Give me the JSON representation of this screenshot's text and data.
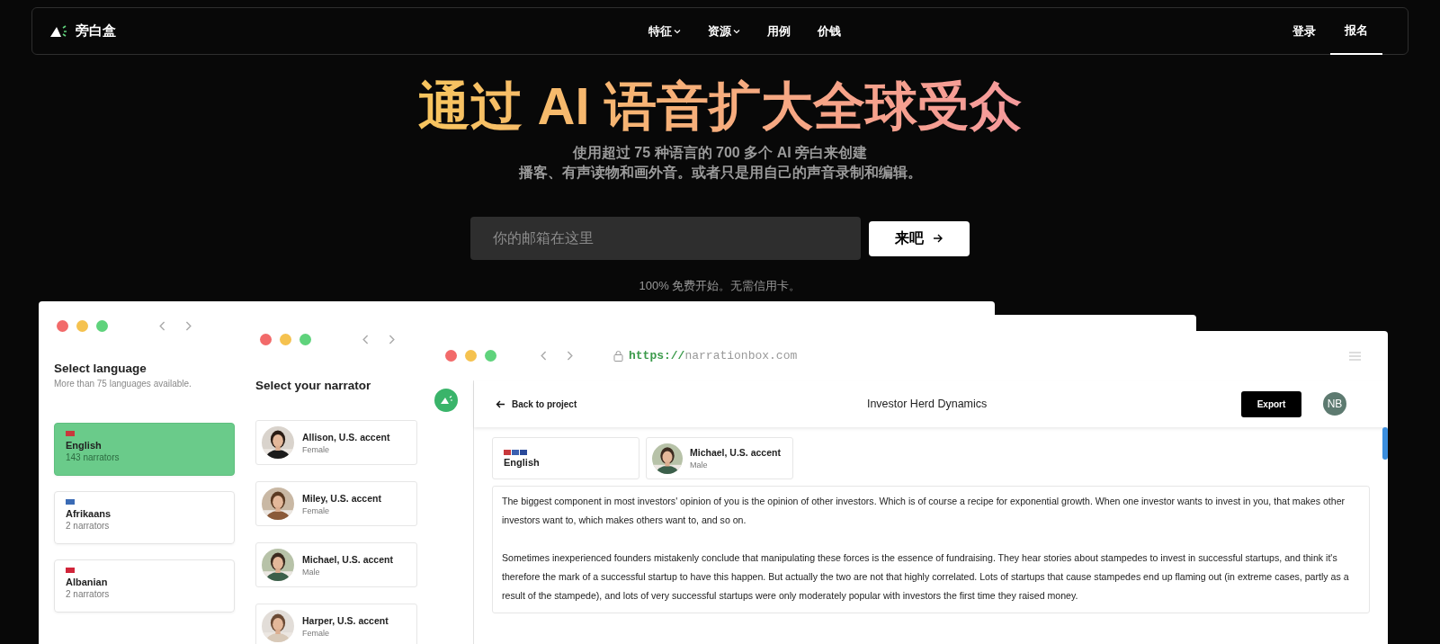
{
  "nav": {
    "logo": "旁白盒",
    "links": [
      {
        "label": "特征",
        "dropdown": true
      },
      {
        "label": "资源",
        "dropdown": true
      },
      {
        "label": "用例",
        "dropdown": false
      },
      {
        "label": "价钱",
        "dropdown": false
      }
    ],
    "login": "登录",
    "signup": "报名"
  },
  "hero": {
    "title": "通过 AI 语音扩大全球受众",
    "subtitle": [
      "使用超过 75 种语言的 700 多个 AI 旁白来创建",
      "播客、有声读物和画外音。或者只是用自己的声音录制和编辑。"
    ],
    "email": {
      "placeholder": "你的邮箱在这里"
    },
    "cta": "来吧",
    "note": "100% 免费开始。无需信用卡。"
  },
  "language_window": {
    "heading": "Select language",
    "subheading": "More than 75 languages available.",
    "languages": [
      {
        "name": "English",
        "count": "143 narrators",
        "selected": true,
        "color": "#c8383c"
      },
      {
        "name": "Afrikaans",
        "count": "2 narrators",
        "selected": false,
        "color": "#3a6bb5"
      },
      {
        "name": "Albanian",
        "count": "2 narrators",
        "selected": false,
        "color": "#d1253a"
      }
    ]
  },
  "narrator_window": {
    "heading": "Select your narrator",
    "narrators": [
      {
        "name": "Allison, U.S. accent",
        "gender": "Female"
      },
      {
        "name": "Miley, U.S. accent",
        "gender": "Female"
      },
      {
        "name": "Michael, U.S. accent",
        "gender": "Male"
      },
      {
        "name": "Harper, U.S. accent",
        "gender": "Female"
      }
    ]
  },
  "editor_window": {
    "url_scheme": "https://",
    "url_host": "narrationbox.com",
    "back": "Back to project",
    "project_title": "Investor Herd Dynamics",
    "export": "Export",
    "avatar": "NB",
    "language_chip": "English",
    "narrator_chip": {
      "name": "Michael, U.S. accent",
      "gender": "Male"
    },
    "paragraphs": [
      "The biggest component in most investors' opinion of you is the opinion of other investors. Which is of course a recipe for exponential growth. When one investor wants to invest in you, that makes other investors want to, which makes others want to, and so on.",
      "Sometimes inexperienced founders mistakenly conclude that manipulating these forces is the essence of fundraising. They hear stories about stampedes to invest in successful startups, and think it's therefore the mark of a successful startup to have this happen. But actually the two are not that highly correlated. Lots of startups that cause stampedes end up flaming out (in extreme cases, partly as a result of the stampede), and lots of very successful startups were only moderately popular with investors the first time they raised money."
    ]
  }
}
